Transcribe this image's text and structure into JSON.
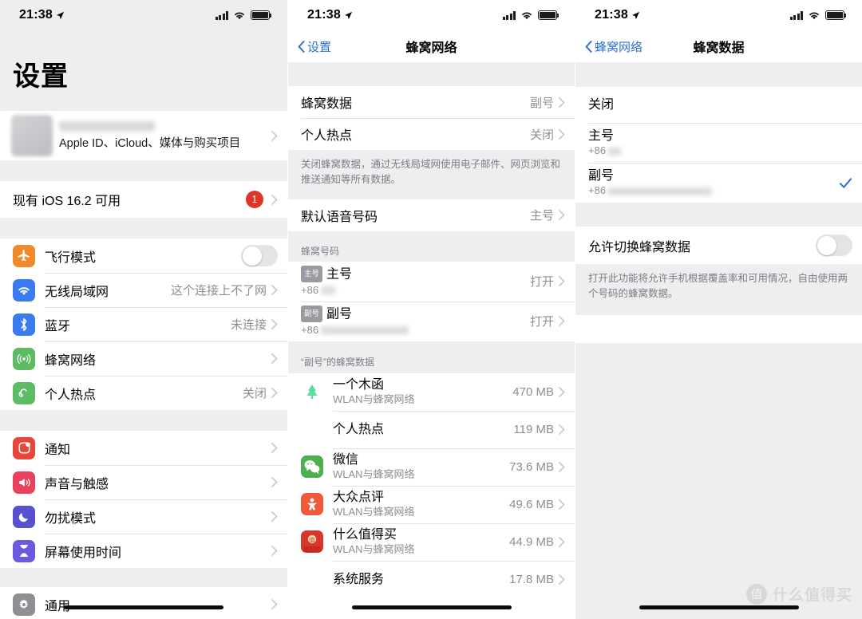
{
  "status_bar": {
    "time": "21:38",
    "location_icon": "location-arrow-icon",
    "signal_icon": "cellular-signal-icon",
    "wifi_icon": "wifi-icon",
    "battery_icon": "battery-icon"
  },
  "colors": {
    "accent_blue": "#2f6fd0",
    "badge_red": "#e0342b",
    "group_bg": "#eeeef0",
    "secondary_text": "#8e8e93",
    "check_blue": "#2f6fd0"
  },
  "panel1": {
    "title": "设置",
    "apple_id": {
      "subtitle": "Apple ID、iCloud、媒体与购买项目"
    },
    "update": {
      "label": "现有 iOS 16.2 可用",
      "badge": "1"
    },
    "group_network": [
      {
        "label": "飞行模式",
        "icon": "airplane-icon",
        "color": "#ef8b2c",
        "control": "toggle",
        "value": ""
      },
      {
        "label": "无线局域网",
        "icon": "wifi-icon",
        "color": "#3a7bf0",
        "control": "chevron",
        "value": "这个连接上不了网"
      },
      {
        "label": "蓝牙",
        "icon": "bluetooth-icon",
        "color": "#3a7bf0",
        "control": "chevron",
        "value": "未连接"
      },
      {
        "label": "蜂窝网络",
        "icon": "cellular-icon",
        "color": "#5cbb63",
        "control": "chevron",
        "value": ""
      },
      {
        "label": "个人热点",
        "icon": "hotspot-icon",
        "color": "#5cbb63",
        "control": "chevron",
        "value": "关闭"
      }
    ],
    "group_notify": [
      {
        "label": "通知",
        "icon": "notification-icon",
        "color": "#e8453c",
        "control": "chevron",
        "value": ""
      },
      {
        "label": "声音与触感",
        "icon": "sound-icon",
        "color": "#e8425c",
        "control": "chevron",
        "value": ""
      },
      {
        "label": "勿扰模式",
        "icon": "moon-icon",
        "color": "#5a4fcf",
        "control": "chevron",
        "value": ""
      },
      {
        "label": "屏幕使用时间",
        "icon": "hourglass-icon",
        "color": "#6a5ae0",
        "control": "chevron",
        "value": ""
      }
    ],
    "group_general": [
      {
        "label": "通用",
        "icon": "gear-icon",
        "color": "#8e8e93",
        "control": "chevron",
        "value": ""
      }
    ]
  },
  "panel2": {
    "back": "设置",
    "title": "蜂窝网络",
    "group_top": [
      {
        "label": "蜂窝数据",
        "value": "副号"
      },
      {
        "label": "个人热点",
        "value": "关闭"
      }
    ],
    "footnote": "关闭蜂窝数据，通过无线局域网使用电子邮件、网页浏览和推送通知等所有数据。",
    "voice_row": {
      "label": "默认语音号码",
      "value": "主号"
    },
    "numbers_header": "蜂窝号码",
    "numbers": [
      {
        "badge": "主号",
        "name": "主号",
        "sub": "+86",
        "value": "打开"
      },
      {
        "badge": "副号",
        "name": "副号",
        "sub": "+86",
        "value": "打开"
      }
    ],
    "apps_header": "“副号”的蜂窝数据",
    "apps": [
      {
        "name": "一个木函",
        "sub": "WLAN与蜂窝网络",
        "size": "470 MB",
        "icon": "tree-app-icon",
        "color": "#ffffff"
      },
      {
        "name": "个人热点",
        "sub": "",
        "size": "119 MB",
        "icon": "none",
        "color": ""
      },
      {
        "name": "微信",
        "sub": "WLAN与蜂窝网络",
        "size": "73.6 MB",
        "icon": "wechat-icon",
        "color": "#4caf50"
      },
      {
        "name": "大众点评",
        "sub": "WLAN与蜂窝网络",
        "size": "49.6 MB",
        "icon": "dianping-icon",
        "color": "#f0593a"
      },
      {
        "name": "什么值得买",
        "sub": "WLAN与蜂窝网络",
        "size": "44.9 MB",
        "icon": "smzdm-icon",
        "color": "#d9352b"
      },
      {
        "name": "系统服务",
        "sub": "",
        "size": "17.8 MB",
        "icon": "none",
        "color": ""
      }
    ]
  },
  "panel3": {
    "back": "蜂窝网络",
    "title": "蜂窝数据",
    "options": [
      {
        "label": "关闭",
        "sub": "",
        "selected": false
      },
      {
        "label": "主号",
        "sub": "+86",
        "selected": false
      },
      {
        "label": "副号",
        "sub": "+86",
        "selected": true
      }
    ],
    "switch_row": {
      "label": "允许切换蜂窝数据",
      "state": "off"
    },
    "footnote": "打开此功能将允许手机根据覆盖率和可用情况，自由使用两个号码的蜂窝数据。",
    "watermark": {
      "mark": "值",
      "text": "什么值得买"
    }
  }
}
